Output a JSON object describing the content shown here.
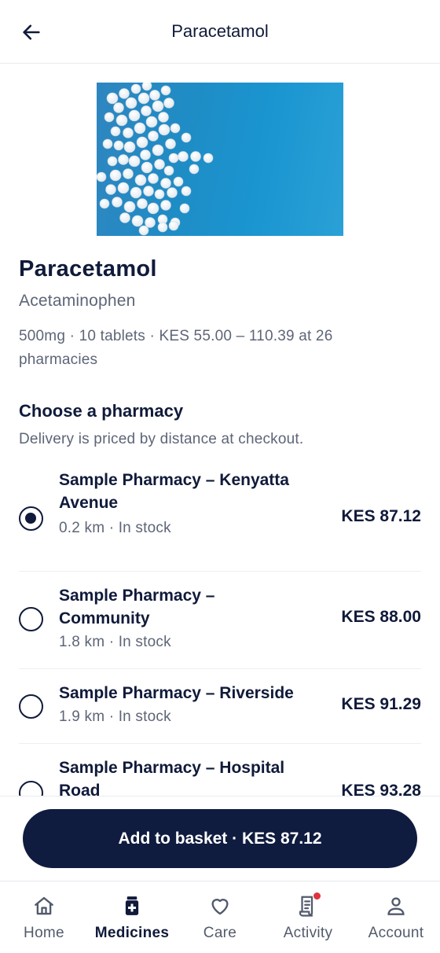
{
  "header": {
    "title": "Paracetamol",
    "back_icon": "arrow-left-icon"
  },
  "product": {
    "name": "Paracetamol",
    "generic": "Acetaminophen",
    "summary": "500mg · 10 tablets · KES 55.00 – 110.39 at 26 pharmacies"
  },
  "pharmacy_section": {
    "title": "Choose a pharmacy",
    "subtitle": "Delivery is priced by distance at checkout.",
    "items": [
      {
        "name": "Sample Pharmacy – Kenyatta Avenue",
        "meta": "0.2 km · In stock",
        "price": "KES 87.12",
        "selected": true
      },
      {
        "name": "Sample Pharmacy – Community",
        "meta": "1.8 km · In stock",
        "price": "KES 88.00",
        "selected": false
      },
      {
        "name": "Sample Pharmacy – Riverside",
        "meta": "1.9 km · In stock",
        "price": "KES 91.29",
        "selected": false
      },
      {
        "name": "Sample Pharmacy – Hospital Road",
        "meta": "",
        "price": "KES 93.28",
        "selected": false
      }
    ]
  },
  "cta": {
    "label": "Add to basket · KES 87.12"
  },
  "nav": {
    "active": "Medicines",
    "items": [
      {
        "label": "Home",
        "icon": "home-icon"
      },
      {
        "label": "Medicines",
        "icon": "pill-bottle-icon"
      },
      {
        "label": "Care",
        "icon": "heart-icon"
      },
      {
        "label": "Activity",
        "icon": "receipt-icon",
        "badge": true
      },
      {
        "label": "Account",
        "icon": "user-icon"
      }
    ]
  },
  "colors": {
    "primary": "#0f1c3f",
    "muted_text": "#5d6577",
    "badge": "#e0333c",
    "hero_blue": "#1f8cc5"
  }
}
